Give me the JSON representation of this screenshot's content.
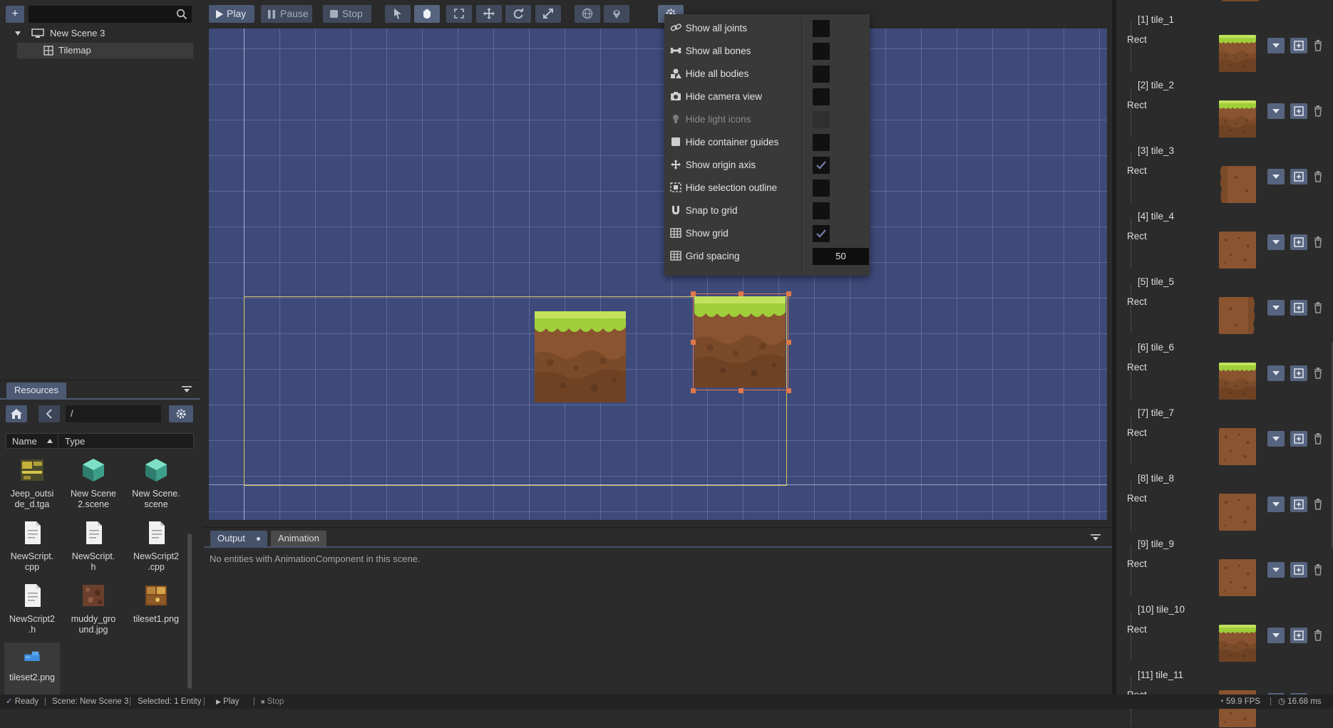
{
  "scene_tree": {
    "root_label": "New Scene 3",
    "child_label": "Tilemap",
    "search_placeholder": ""
  },
  "toolbar": {
    "play": "Play",
    "pause": "Pause",
    "stop": "Stop"
  },
  "resources": {
    "tab": "Resources",
    "path": "/",
    "col_name": "Name",
    "col_type": "Type",
    "items": [
      {
        "name": "Jeep_outsi\nde_d.tga",
        "icon": "texture-icon"
      },
      {
        "name": "New Scene\n2.scene",
        "icon": "scene-icon"
      },
      {
        "name": "New Scene.\nscene",
        "icon": "scene-icon"
      },
      {
        "name": "NewScript.\ncpp",
        "icon": "file-icon"
      },
      {
        "name": "NewScript.\nh",
        "icon": "file-icon"
      },
      {
        "name": "NewScript2\n.cpp",
        "icon": "file-icon"
      },
      {
        "name": "NewScript2\n.h",
        "icon": "file-icon"
      },
      {
        "name": "muddy_gro\nund.jpg",
        "icon": "image-icon"
      },
      {
        "name": "tileset1.png",
        "icon": "image-icon"
      },
      {
        "name": "tileset2.png",
        "icon": "image-icon"
      }
    ]
  },
  "view_menu": {
    "items": [
      {
        "label": "Show all joints",
        "checked": false,
        "icon": "link-icon"
      },
      {
        "label": "Show all bones",
        "checked": false,
        "icon": "bone-icon"
      },
      {
        "label": "Hide all bodies",
        "checked": false,
        "icon": "shapes-icon"
      },
      {
        "label": "Hide camera view",
        "checked": false,
        "icon": "camera-icon"
      },
      {
        "label": "Hide light icons",
        "checked": false,
        "icon": "bulb-icon",
        "disabled": true
      },
      {
        "label": "Hide container guides",
        "checked": false,
        "icon": "square-icon"
      },
      {
        "label": "Show origin axis",
        "checked": true,
        "icon": "move-icon"
      },
      {
        "label": "Hide selection outline",
        "checked": false,
        "icon": "selection-icon"
      },
      {
        "label": "Snap to grid",
        "checked": false,
        "icon": "magnet-icon"
      },
      {
        "label": "Show grid",
        "checked": true,
        "icon": "grid-icon"
      }
    ],
    "grid_spacing_label": "Grid spacing",
    "grid_spacing_value": "50"
  },
  "output": {
    "tab_output": "Output",
    "tab_animation": "Animation",
    "message": "No entities with AnimationComponent in this scene."
  },
  "tiles": [
    {
      "label": "[1] tile_1",
      "type": "Rect",
      "thumb": "grass"
    },
    {
      "label": "[2] tile_2",
      "type": "Rect",
      "thumb": "grass"
    },
    {
      "label": "[3] tile_3",
      "type": "Rect",
      "thumb": "dirt-edge"
    },
    {
      "label": "[4] tile_4",
      "type": "Rect",
      "thumb": "dirt"
    },
    {
      "label": "[5] tile_5",
      "type": "Rect",
      "thumb": "dirt-edge-right"
    },
    {
      "label": "[6] tile_6",
      "type": "Rect",
      "thumb": "grass"
    },
    {
      "label": "[7] tile_7",
      "type": "Rect",
      "thumb": "dirt"
    },
    {
      "label": "[8] tile_8",
      "type": "Rect",
      "thumb": "dirt"
    },
    {
      "label": "[9] tile_9",
      "type": "Rect",
      "thumb": "dirt"
    },
    {
      "label": "[10] tile_10",
      "type": "Rect",
      "thumb": "grass"
    },
    {
      "label": "[11] tile_11",
      "type": "Rect",
      "thumb": "dirt"
    }
  ],
  "status": {
    "ready": "Ready",
    "scene": "Scene: New Scene 3",
    "selected": "Selected: 1 Entity",
    "play": "Play",
    "stop": "Stop",
    "fps": "59.9 FPS",
    "ms": "16.68 ms"
  },
  "colors": {
    "accent": "#4b5874",
    "viewport_bg": "#3e4a7a",
    "grass": "#9fcf3a",
    "dirt": "#8a5430",
    "selection_handle": "#e0784a",
    "bounds_outline": "#d7c764"
  }
}
